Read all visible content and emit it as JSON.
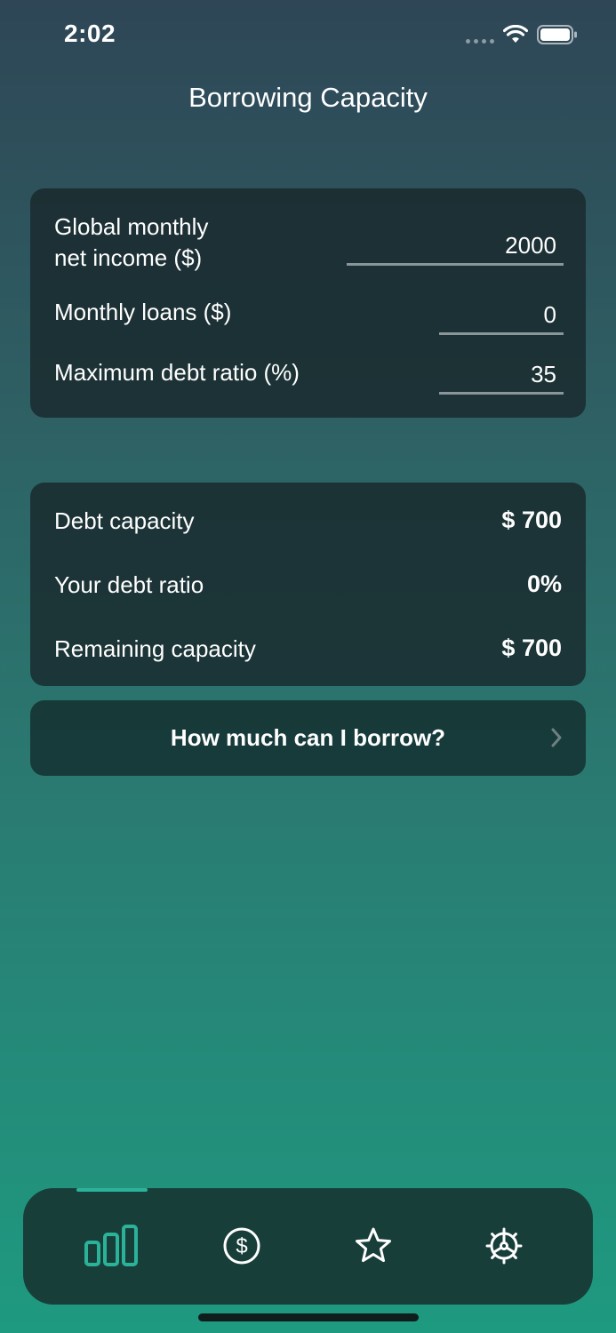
{
  "status_bar": {
    "time": "2:02"
  },
  "header": {
    "title": "Borrowing Capacity"
  },
  "inputs": {
    "income": {
      "label_line1": "Global monthly",
      "label_line2": "net income ($)",
      "value": "2000"
    },
    "loans": {
      "label": "Monthly loans ($)",
      "value": "0"
    },
    "max_ratio": {
      "label": "Maximum debt ratio (%)",
      "value": "35"
    }
  },
  "results": {
    "debt_capacity": {
      "label": "Debt capacity",
      "value": "$ 700"
    },
    "debt_ratio": {
      "label": "Your debt ratio",
      "value": "0%"
    },
    "remaining": {
      "label": "Remaining capacity",
      "value": "$ 700"
    }
  },
  "cta": {
    "label": "How much can I borrow?"
  },
  "tab_bar": {
    "active_tab": "capacity",
    "accent_color": "#2bb39a",
    "tabs": [
      {
        "icon": "bar-chart-icon",
        "active": true
      },
      {
        "icon": "dollar-circle-icon",
        "active": false
      },
      {
        "icon": "star-icon",
        "active": false
      },
      {
        "icon": "settings-icon",
        "active": false
      }
    ]
  }
}
